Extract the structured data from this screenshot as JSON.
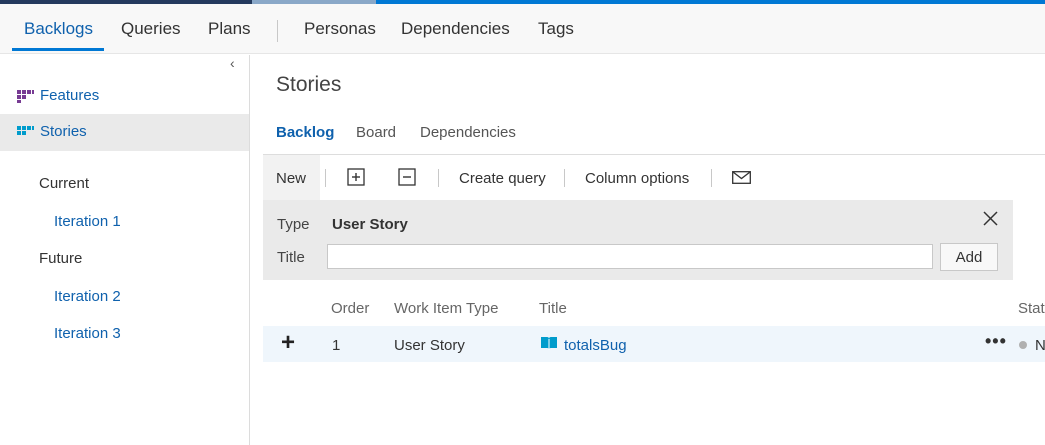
{
  "hub": {
    "tabs": [
      {
        "label": "Backlogs"
      },
      {
        "label": "Queries"
      },
      {
        "label": "Plans"
      },
      {
        "label": "Personas"
      },
      {
        "label": "Dependencies"
      },
      {
        "label": "Tags"
      }
    ],
    "active": "Backlogs"
  },
  "sidebar": {
    "collapse_glyph": "‹",
    "levels": [
      {
        "label": "Features",
        "icon": "features-backlog-icon",
        "color": "#773b93"
      },
      {
        "label": "Stories",
        "icon": "stories-backlog-icon",
        "color": "#009ccc",
        "selected": true
      }
    ],
    "current_label": "Current",
    "current_iterations": [
      "Iteration 1"
    ],
    "future_label": "Future",
    "future_iterations": [
      "Iteration 2",
      "Iteration 3"
    ]
  },
  "main": {
    "title": "Stories",
    "pivots": [
      {
        "label": "Backlog",
        "active": true
      },
      {
        "label": "Board"
      },
      {
        "label": "Dependencies"
      }
    ]
  },
  "toolbar": {
    "new_label": "New",
    "expand_icon": "expand-all-icon",
    "collapse_icon": "collapse-all-icon",
    "create_query_label": "Create query",
    "column_options_label": "Column options",
    "email_icon": "mail-icon"
  },
  "add_panel": {
    "type_label": "Type",
    "type_value": "User Story",
    "title_label": "Title",
    "title_value": "",
    "add_label": "Add",
    "close_icon": "close-icon"
  },
  "grid": {
    "columns": [
      "Order",
      "Work Item Type",
      "Title",
      "Stat"
    ],
    "rows": [
      {
        "order": "1",
        "type": "User Story",
        "title": "totalsBug",
        "state": "N",
        "icon": "user-story-icon",
        "icon_color": "#009ccc"
      }
    ]
  },
  "colors": {
    "accent": "#0078d4",
    "link": "#0f61ad",
    "selected_row": "#eff6fc"
  }
}
